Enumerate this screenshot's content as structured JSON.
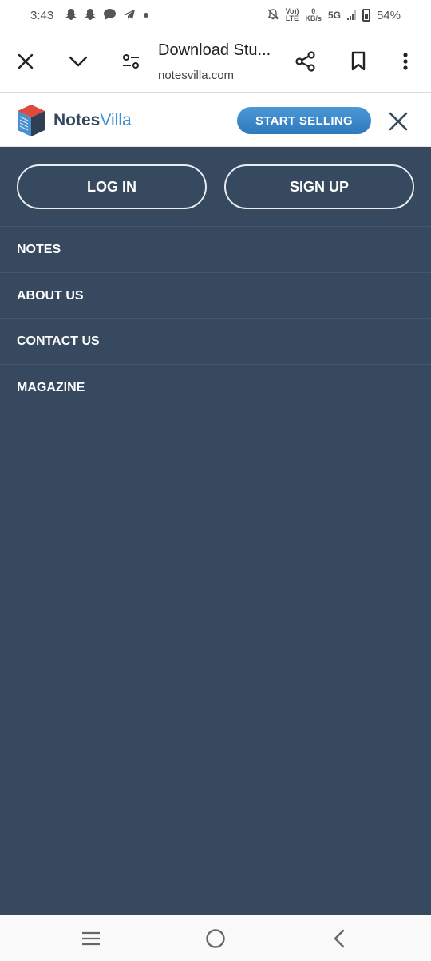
{
  "status_bar": {
    "time": "3:43",
    "left_icons": [
      "snapchat-icon",
      "snapchat-icon",
      "message-icon",
      "telegram-icon",
      "dot-icon"
    ],
    "volte_top": "Vo))",
    "volte_bottom": "LTE",
    "speed_value": "0",
    "speed_unit": "KB/s",
    "network": "5G",
    "battery": "54%"
  },
  "browser": {
    "title": "Download Stu...",
    "url": "notesvilla.com",
    "icons": [
      "close-icon",
      "chevron-down-icon",
      "page-settings-icon",
      "share-icon",
      "bookmark-icon",
      "more-vert-icon"
    ]
  },
  "site_header": {
    "brand_part1": "Notes",
    "brand_part2": "Villa",
    "cta_label": "START SELLING",
    "colors": {
      "brand_dark": "#35495e",
      "brand_blue": "#3d8fcf",
      "button_blue": "#3a87c9"
    }
  },
  "menu": {
    "login_label": "LOG IN",
    "signup_label": "SIGN UP",
    "items": [
      {
        "label": "NOTES"
      },
      {
        "label": "ABOUT US"
      },
      {
        "label": "CONTACT US"
      },
      {
        "label": "MAGAZINE"
      }
    ],
    "background": "#36495f"
  },
  "nav_bar": {
    "icons": [
      "recent-apps-icon",
      "home-icon",
      "back-icon"
    ]
  }
}
